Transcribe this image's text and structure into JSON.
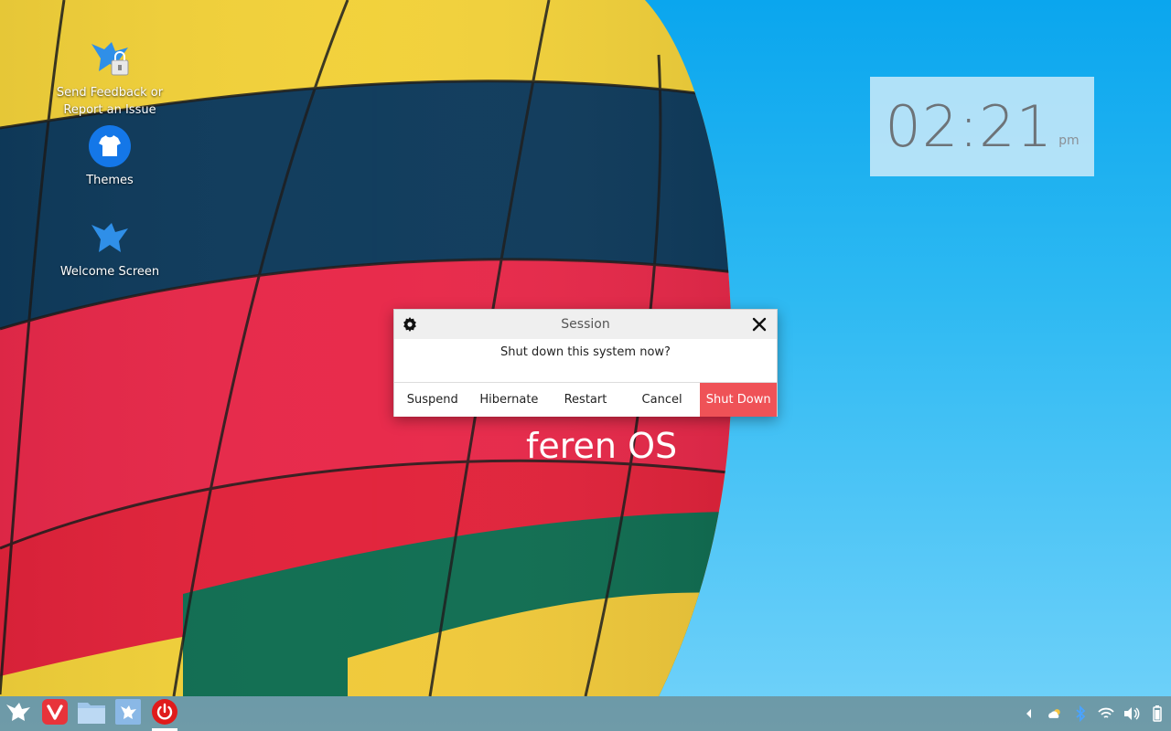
{
  "desktop": {
    "icons": [
      {
        "label": "Send Feedback or Report an Issue",
        "icon": "feedback-bird-lock-icon"
      },
      {
        "label": "Themes",
        "icon": "themes-shirt-icon"
      },
      {
        "label": "Welcome Screen",
        "icon": "welcome-bird-icon"
      }
    ],
    "brand_text": "feren OS"
  },
  "clock": {
    "time": "02:21",
    "ampm": "pm"
  },
  "dialog": {
    "title": "Session",
    "message": "Shut down this system now?",
    "buttons": {
      "suspend": "Suspend",
      "hibernate": "Hibernate",
      "restart": "Restart",
      "cancel": "Cancel",
      "shutdown": "Shut Down"
    },
    "danger_color": "#ef5257"
  },
  "taskbar": {
    "launchers": [
      "menu-bird-icon",
      "vivaldi-browser-icon",
      "file-manager-folder-icon",
      "feren-store-icon",
      "power-icon"
    ],
    "tray": [
      "arrow-left-icon",
      "weather-icon",
      "bluetooth-icon",
      "wifi-icon",
      "volume-icon",
      "battery-icon"
    ]
  },
  "colors": {
    "sky": "#0aa6ee",
    "taskbar": "#6e6e64",
    "accent_red": "#ef5257"
  }
}
